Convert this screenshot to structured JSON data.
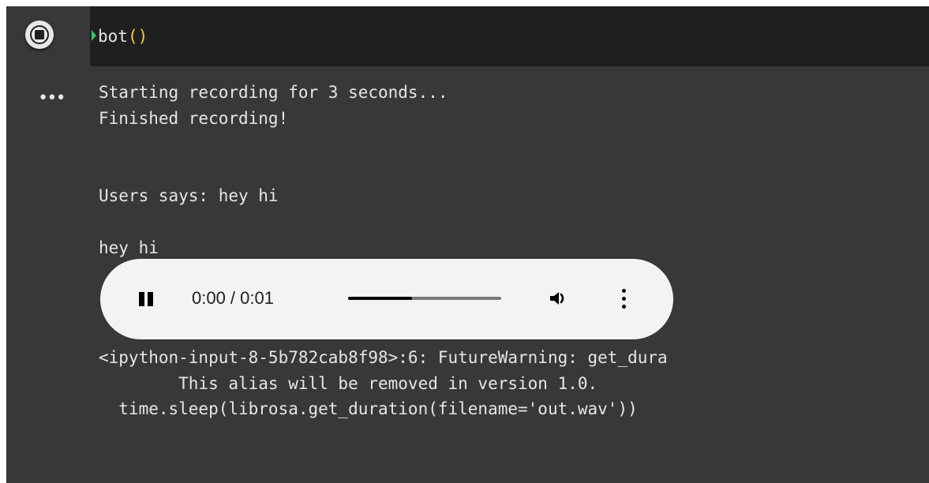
{
  "cell": {
    "code": "bot",
    "code_parens": "()",
    "output_menu_icon": "ellipsis-icon"
  },
  "output": {
    "lines": [
      "Starting recording for 3 seconds...",
      "Finished recording!",
      "Users says: hey hi",
      "hey hi"
    ],
    "warning": [
      "<ipython-input-8-5b782cab8f98>:6: FutureWarning: get_dura",
      "        This alias will be removed in version 1.0.",
      "  time.sleep(librosa.get_duration(filename='out.wav'))"
    ]
  },
  "audio": {
    "time": "0:00 / 0:01",
    "progress_fraction": 0.42,
    "state": "playing"
  },
  "colors": {
    "cell_background": "#383838",
    "header_background": "#1f1f1f",
    "text": "#e6e6e6",
    "paren": "#f2c94c",
    "run_marker": "#35c46a",
    "player_background": "#f1f3f4"
  }
}
